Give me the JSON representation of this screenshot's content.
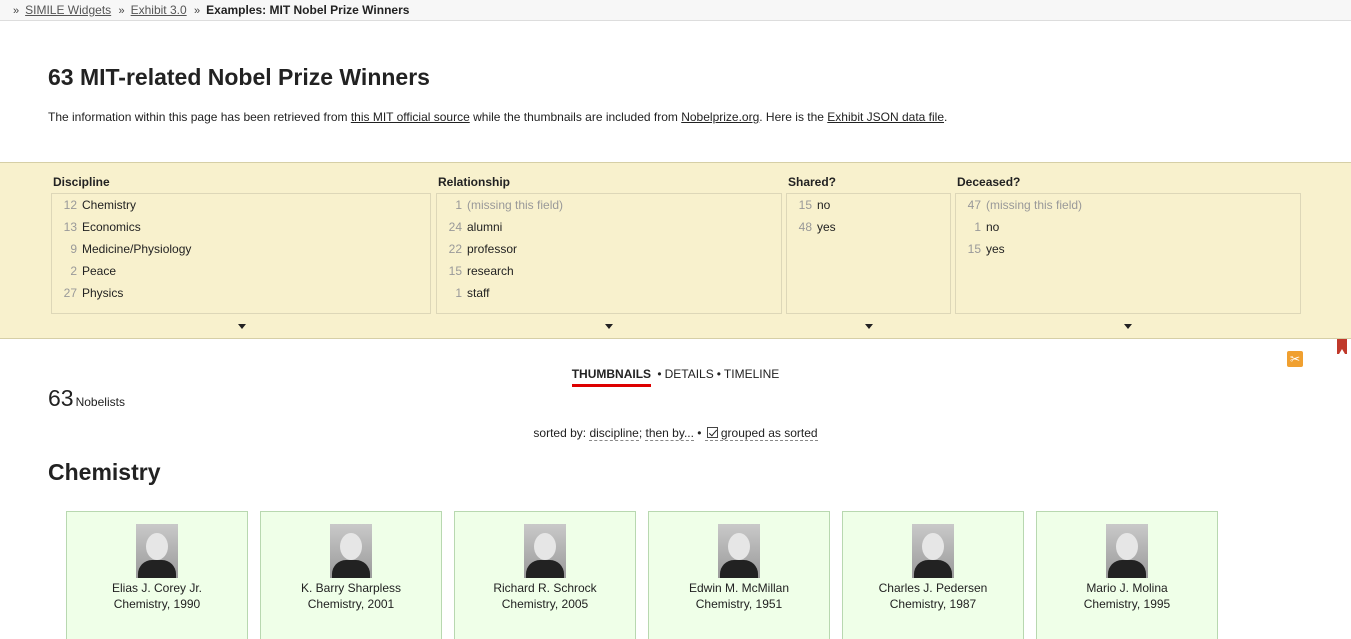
{
  "breadcrumb": {
    "items": [
      "SIMILE Widgets",
      "Exhibit 3.0"
    ],
    "current": "Examples: MIT Nobel Prize Winners",
    "separator": "»"
  },
  "page": {
    "title": "63 MIT-related Nobel Prize Winners",
    "intro_1": "The information within this page has been retrieved from ",
    "intro_link1": "this MIT official source",
    "intro_2": " while the thumbnails are included from ",
    "intro_link2": "Nobelprize.org",
    "intro_3": ". Here is the ",
    "intro_link3": "Exhibit JSON data file",
    "intro_4": "."
  },
  "facets": [
    {
      "title": "Discipline",
      "rows": [
        {
          "count": "12",
          "value": "Chemistry"
        },
        {
          "count": "13",
          "value": "Economics"
        },
        {
          "count": "9",
          "value": "Medicine/Physiology"
        },
        {
          "count": "2",
          "value": "Peace"
        },
        {
          "count": "27",
          "value": "Physics"
        }
      ]
    },
    {
      "title": "Relationship",
      "rows": [
        {
          "count": "1",
          "value": "(missing this field)",
          "missing": true
        },
        {
          "count": "24",
          "value": "alumni"
        },
        {
          "count": "22",
          "value": "professor"
        },
        {
          "count": "15",
          "value": "research"
        },
        {
          "count": "1",
          "value": "staff"
        }
      ]
    },
    {
      "title": "Shared?",
      "rows": [
        {
          "count": "15",
          "value": "no"
        },
        {
          "count": "48",
          "value": "yes"
        }
      ]
    },
    {
      "title": "Deceased?",
      "rows": [
        {
          "count": "47",
          "value": "(missing this field)",
          "missing": true
        },
        {
          "count": "1",
          "value": "no"
        },
        {
          "count": "15",
          "value": "yes"
        }
      ]
    }
  ],
  "views": {
    "active": "THUMBNAILS",
    "others": [
      "DETAILS",
      "TIMELINE"
    ],
    "separator": "•"
  },
  "results": {
    "count": "63",
    "label": "Nobelists"
  },
  "sort": {
    "prefix": "sorted by: ",
    "field": "discipline",
    "then": "then by...",
    "grouped": "grouped as sorted"
  },
  "group": {
    "title": "Chemistry"
  },
  "cards": [
    {
      "name": "Elias J. Corey Jr.",
      "discipline": "Chemistry, 1990"
    },
    {
      "name": "K. Barry Sharpless",
      "discipline": "Chemistry, 2001"
    },
    {
      "name": "Richard R. Schrock",
      "discipline": "Chemistry, 2005"
    },
    {
      "name": "Edwin M. McMillan",
      "discipline": "Chemistry, 1951"
    },
    {
      "name": "Charles J. Pedersen",
      "discipline": "Chemistry, 1987"
    },
    {
      "name": "Mario J. Molina",
      "discipline": "Chemistry, 1995"
    }
  ]
}
